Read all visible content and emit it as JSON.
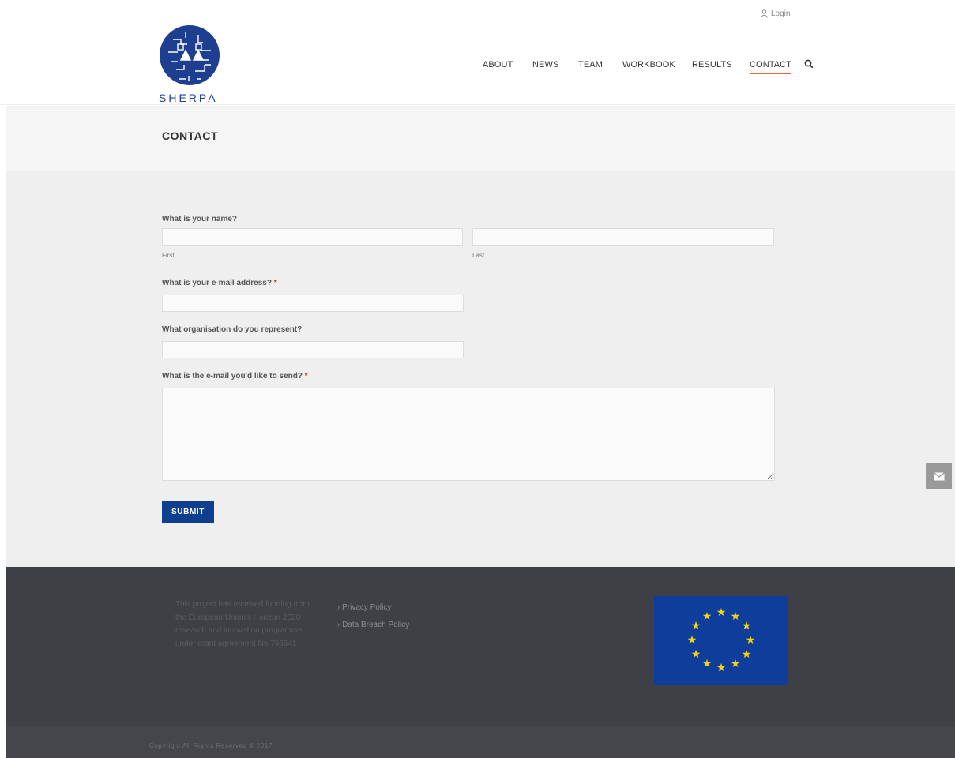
{
  "brand": {
    "name": "SHERPA",
    "primary_color": "#0e3f8e",
    "accent_color": "#e8623d"
  },
  "header": {
    "login_label": "Login",
    "nav": [
      {
        "label": "ABOUT"
      },
      {
        "label": "NEWS"
      },
      {
        "label": "TEAM"
      },
      {
        "label": "WORKBOOK"
      },
      {
        "label": "RESULTS"
      },
      {
        "label": "CONTACT",
        "active": true
      }
    ],
    "search_icon": "search-icon"
  },
  "page": {
    "title": "CONTACT"
  },
  "form": {
    "name_label": "What is your name?",
    "first_sublabel": "First",
    "last_sublabel": "Last",
    "email_label": "What is your e-mail address?",
    "org_label": "What organisation do you represent?",
    "message_label": "What is the e-mail you'd like to send?",
    "required_mark": "*",
    "first_value": "",
    "last_value": "",
    "email_value": "",
    "org_value": "",
    "message_value": "",
    "submit_label": "SUBMIT"
  },
  "side_tab": {
    "icon": "envelope-icon"
  },
  "footer": {
    "funding_text": "This project has received funding from the European Union's Horizon 2020 research and innovation programme, under grant agreement No 786641",
    "links": [
      {
        "label": "Privacy Policy"
      },
      {
        "label": "Data Breach Policy"
      }
    ],
    "flag_icon": "eu-flag-icon",
    "copyright": "Copyright All Rights Reserved © 2017"
  }
}
